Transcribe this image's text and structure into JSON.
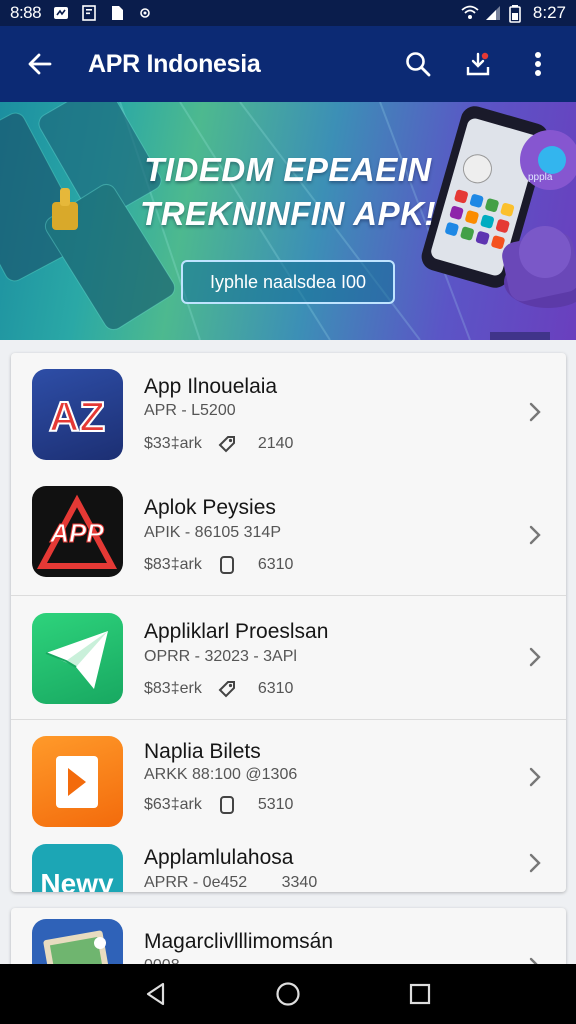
{
  "status_bar": {
    "time_left": "8:88",
    "time_right": "8:27"
  },
  "app_bar": {
    "title": "APR Indonesia"
  },
  "banner": {
    "headline_line1": "TIDEDM EPEAEIN",
    "headline_line2": "TREKNINFIN APK!",
    "cta_label": "Iyphle naalsdea I00",
    "mini_label": "pppla"
  },
  "apps": [
    {
      "name": "App Ilnouelaia",
      "meta": "APR - L5200",
      "size": "$33‡ark",
      "count": "2140",
      "icon": "az-logo-icon",
      "stat_icon": "tag-icon",
      "icon_text": "AZ"
    },
    {
      "name": "Aplok Peysies",
      "meta": "APIK - 86105  314P",
      "size": "$83‡ark",
      "count": "6310",
      "icon": "app-logo-icon",
      "stat_icon": "phone-icon",
      "icon_text": "APP"
    },
    {
      "name": "Appliklarl Proeslsan",
      "meta": "OPRR - 32023 - 3APl",
      "size": "$83‡erk",
      "count": "6310",
      "icon": "paper-plane-icon",
      "stat_icon": "tag-icon",
      "icon_text": ""
    },
    {
      "name": "Naplia Bilets",
      "meta": "ARKK 88:100  @1306",
      "size": "$63‡ark",
      "count": "5310",
      "icon": "play-d-icon",
      "stat_icon": "phone-icon",
      "icon_text": "D"
    },
    {
      "name": "Applamlulahosa",
      "meta": "APRR - 0e452",
      "size": "",
      "count": "3340",
      "icon": "newy-icon",
      "stat_icon": "",
      "icon_text": "Newy"
    }
  ],
  "card2_app": {
    "name": "Magarclivlllimomsán",
    "meta": "0008",
    "icon": "gallery-icon"
  },
  "colors": {
    "app_bar": "#0c2a74",
    "status_bar": "#0a1d4c",
    "banner_start": "#1c8ea0",
    "banner_end": "#6a3fbe"
  }
}
